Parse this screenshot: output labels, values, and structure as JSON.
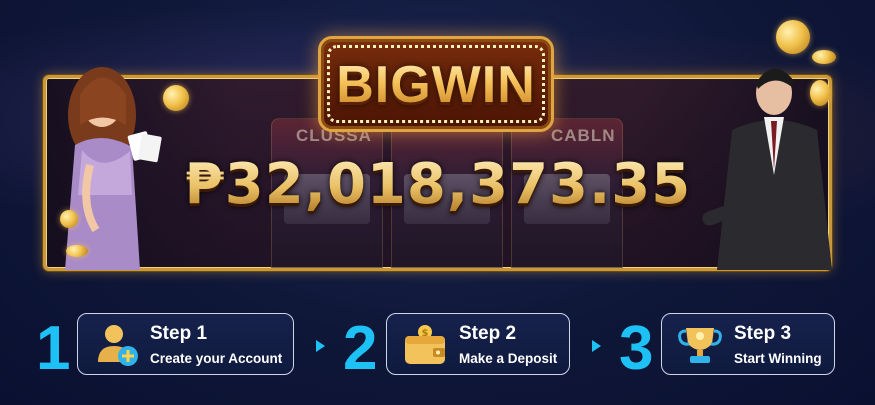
{
  "banner": {
    "sign_text": "BIGWIN",
    "jackpot_amount": "₱32,018,373.35",
    "slot_labels": [
      "CLUSSA",
      "CABLN"
    ]
  },
  "steps": [
    {
      "number": "1",
      "title": "Step 1",
      "subtitle": "Create your Account",
      "icon": "add-user-icon"
    },
    {
      "number": "2",
      "title": "Step 2",
      "subtitle": "Make a Deposit",
      "icon": "wallet-icon"
    },
    {
      "number": "3",
      "title": "Step 3",
      "subtitle": "Start Winning",
      "icon": "trophy-icon"
    }
  ],
  "colors": {
    "accent": "#1ec1f5",
    "gold": "#e0a443",
    "background": "#0f1738",
    "card_border": "#cfd6e8"
  }
}
